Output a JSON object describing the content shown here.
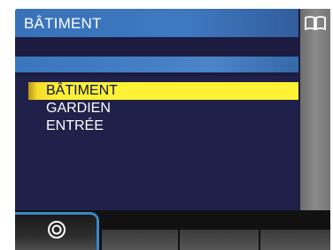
{
  "header": {
    "title": "BÂTIMENT"
  },
  "menu": {
    "items": [
      {
        "label": "BÂTIMENT",
        "selected": true
      },
      {
        "label": "GARDIEN",
        "selected": false
      },
      {
        "label": "ENTRÉE",
        "selected": false
      }
    ]
  },
  "scrollbar": {
    "icon": "book-icon"
  },
  "softkeys": {
    "left_icon": "target-icon"
  },
  "colors": {
    "accent": "#3b86c8",
    "selection": "#fdf236",
    "background": "#1b1b3e"
  }
}
